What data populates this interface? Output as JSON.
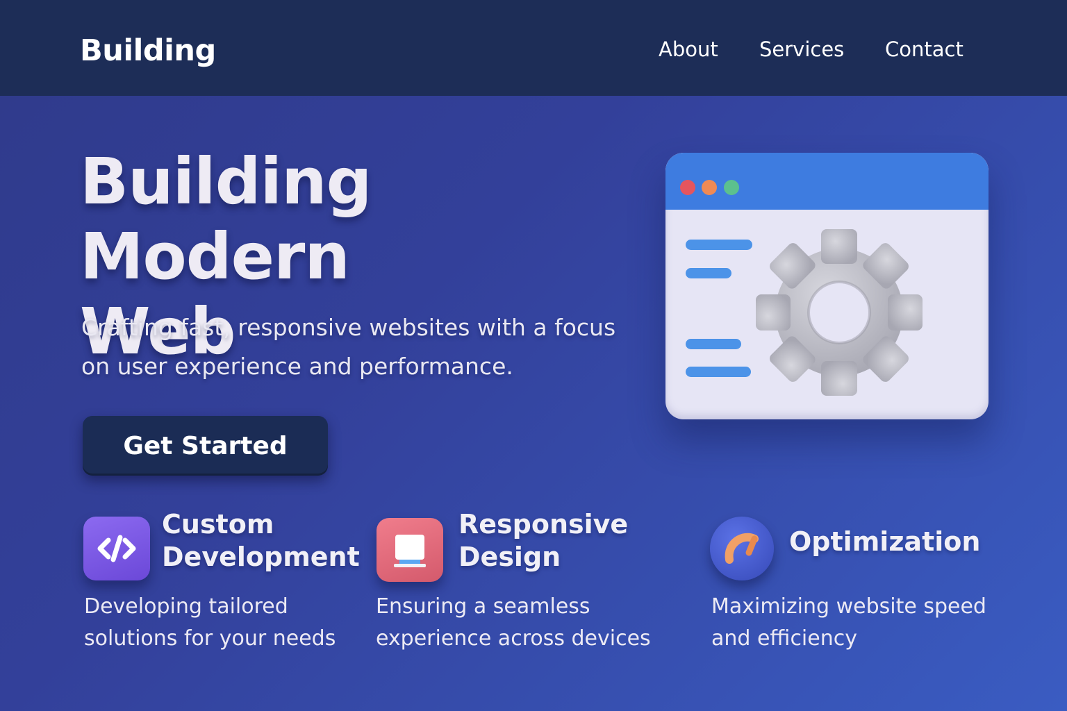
{
  "nav": {
    "brand": "Building",
    "links": [
      {
        "label": "About"
      },
      {
        "label": "Services"
      },
      {
        "label": "Contact"
      }
    ]
  },
  "hero": {
    "title_line1": "Building Modern",
    "title_line2": "Web",
    "subtitle_line1": "Crafting fast, responsive websites with a focus",
    "subtitle_line2": "on user experience and performance.",
    "cta_label": "Get Started"
  },
  "features": [
    {
      "icon": "code-icon",
      "title_line1": "Custom",
      "title_line2": "Development",
      "desc_line1": "Developing tailored",
      "desc_line2": "solutions for your needs"
    },
    {
      "icon": "monitor-icon",
      "title_line1": "Responsive",
      "title_line2": "Design",
      "desc_line1": "Ensuring a seamless",
      "desc_line2": "experience across devices"
    },
    {
      "icon": "speed-gauge-icon",
      "title_line1": "Optimization",
      "desc_line1": "Maximizing website speed",
      "desc_line2": "and efficiency"
    }
  ],
  "illustration": {
    "icon": "browser-window-gear-icon",
    "colors": {
      "window_bar": "#3e7ce0",
      "dot_red": "#e5555e",
      "dot_orange": "#ef8a55",
      "dot_green": "#5cc08e",
      "gear": "#bdbdc6"
    }
  },
  "colors": {
    "navbar": "#1d2d57",
    "button": "#1b2c55",
    "background_start": "#2f3a8a",
    "background_end": "#3a5cc2"
  }
}
